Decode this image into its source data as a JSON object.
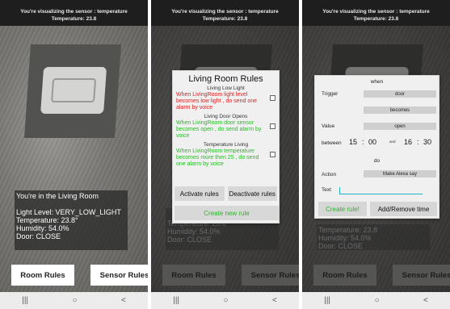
{
  "header": {
    "line1": "You're visualizing the sensor : temperature",
    "line2": "Temperature: 23.8"
  },
  "info": {
    "room": "You're in the Living Room",
    "light": "Light Level: VERY_LOW_LIGHT",
    "temperature": "Temperature: 23.8°",
    "humidity": "Humidity: 54.0%",
    "door": "Door: CLOSE"
  },
  "dim_info": {
    "temperature": "Temperature: 23.8",
    "humidity": "Humidity: 54.0%",
    "door": "Door: CLOSE"
  },
  "buttons": {
    "room_rules": "Room Rules",
    "sensor_rules": "Sensor Rules"
  },
  "nav": {
    "recent": "|||",
    "home": "○",
    "back": "<"
  },
  "rules_modal": {
    "title": "Living Room Rules",
    "rules": [
      {
        "name": "Living Low Light",
        "text": "When  LivingRoom light level becomes  low light ,  do send  one alarm  by voice",
        "color": "#e01e1e"
      },
      {
        "name": "Living Door Opens",
        "text": "When  LivingRoom door sensor becomes  open ,  do send  alarm by voice",
        "color": "#1fc01f"
      },
      {
        "name": "Temperature Living",
        "text": "When  LivingRoom temperature becomes  more then  25 ,  do send  one  alarm  by voice",
        "color": "#1fc01f"
      }
    ],
    "activate": "Activate rules",
    "deactivate": "Deactivate rules",
    "create_new": "Create new rule"
  },
  "create_modal": {
    "when": "when",
    "trigger_label": "Trigger",
    "trigger_value": "door",
    "becomes": "becomes",
    "value_label": "Value",
    "value_value": "open",
    "between_label": "between",
    "h1": "15",
    "m1": "00",
    "and": "and",
    "h2": "16",
    "m2": "30",
    "colon": ":",
    "do": "do",
    "action_label": "Action",
    "action_value": "Make Alexa say",
    "text_label": "Text",
    "create_btn": "Create rule!",
    "add_remove_btn": "Add/Remove time",
    "behind_title": "Living Room Rules"
  },
  "colors": {
    "accent_green": "#2bb52b",
    "cursor_teal": "#1fb5c8"
  }
}
